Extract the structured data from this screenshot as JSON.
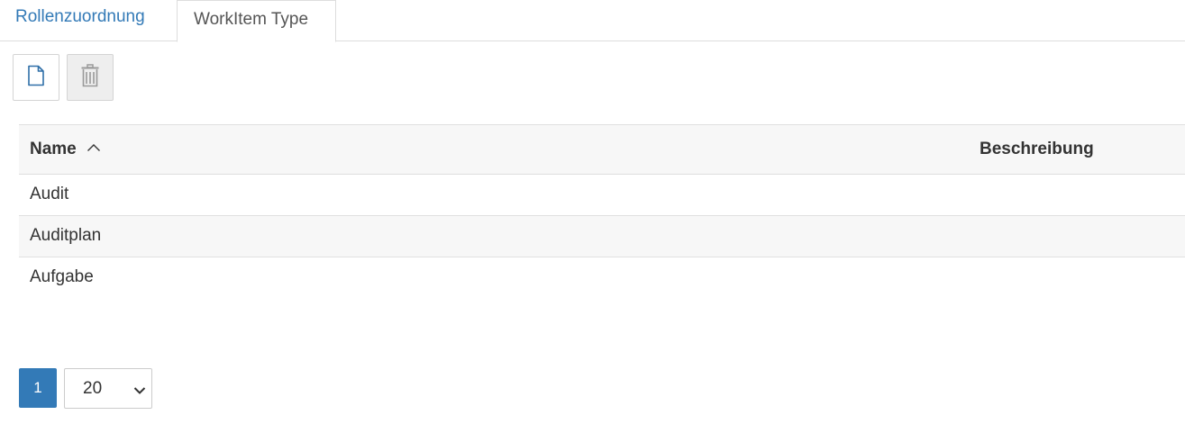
{
  "tabs": [
    {
      "label": "Rollenzuordnung",
      "active": false
    },
    {
      "label": "WorkItem Type",
      "active": true
    }
  ],
  "toolbar": {
    "new_icon": "document-new-icon",
    "delete_icon": "trash-icon",
    "delete_disabled": true
  },
  "grid": {
    "columns": [
      {
        "label": "Name",
        "sort": "ascending"
      },
      {
        "label": "Beschreibung"
      }
    ],
    "rows": [
      {
        "name": "Audit",
        "description": ""
      },
      {
        "name": "Auditplan",
        "description": ""
      },
      {
        "name": "Aufgabe",
        "description": ""
      }
    ]
  },
  "pager": {
    "current_page": "1",
    "page_size": "20"
  },
  "colors": {
    "accent": "#337ab7",
    "header_bg": "#f7f7f7",
    "border": "#dddddd"
  }
}
